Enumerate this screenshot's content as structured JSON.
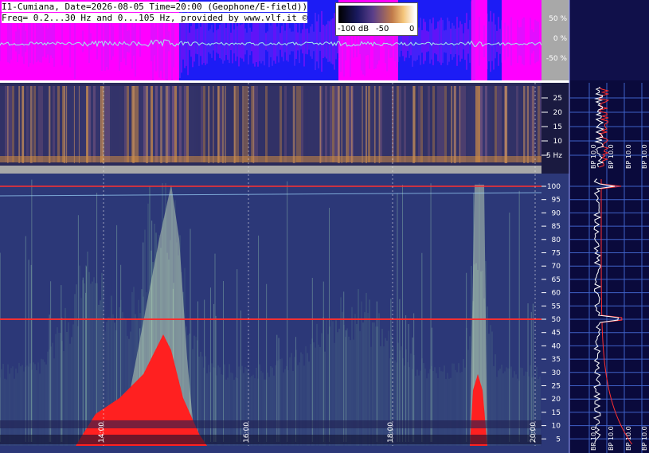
{
  "header": {
    "line1": "I1-Cumiana, Date=2026-08-05 Time=20:00 (Geophone/E-field))",
    "line2": "Freq= 0.2...30 Hz and 0...105 Hz, provided by www.vlf.it ©"
  },
  "colorbar": {
    "labels": [
      "-100 dB",
      "-50",
      "0"
    ],
    "colors": [
      "#000000",
      "#1a1a60",
      "#5a3e8a",
      "#c07a4a",
      "#f4c57a",
      "#ffffff"
    ]
  },
  "colors": {
    "magenta": "#ff00ff",
    "blue": "#1c1cf5",
    "spectro_bg": "#2c3878",
    "side_bg": "#0a0a3c",
    "red_mark": "#ff2020",
    "gray_axis": "#a8a8a8"
  },
  "chart_data": [
    {
      "type": "area",
      "panel": "geophone amplitude",
      "y_ticks": [
        "50 %",
        "0 %",
        "-50 %"
      ],
      "ylim": [
        -100,
        100
      ]
    },
    {
      "type": "heatmap",
      "panel": "low-frequency spectrogram",
      "y_ticks": [
        "25",
        "20",
        "15",
        "10",
        "5 Hz"
      ],
      "ylim": [
        0.2,
        30
      ]
    },
    {
      "type": "heatmap",
      "panel": "E-field spectrogram",
      "x_ticks": [
        "14:00",
        "16:00",
        "18:00",
        "20:00"
      ],
      "y_ticks": [
        "100",
        "95",
        "90",
        "85",
        "80",
        "75",
        "70",
        "65",
        "60",
        "55",
        "50",
        "45",
        "40",
        "35",
        "30",
        "25",
        "20",
        "15",
        "10",
        "5"
      ],
      "ylim": [
        0,
        105
      ],
      "lines_hz": [
        50,
        100
      ]
    },
    {
      "type": "line",
      "panel": "side spectra",
      "bp_labels_top": [
        "BP 10.0",
        "BP 10.0",
        "BP 10.0",
        "BP 10.0"
      ],
      "bp_labels_bottom": [
        "BP 10.0",
        "BP 10.0",
        "BP 10.0",
        "BP 10.0"
      ]
    }
  ]
}
